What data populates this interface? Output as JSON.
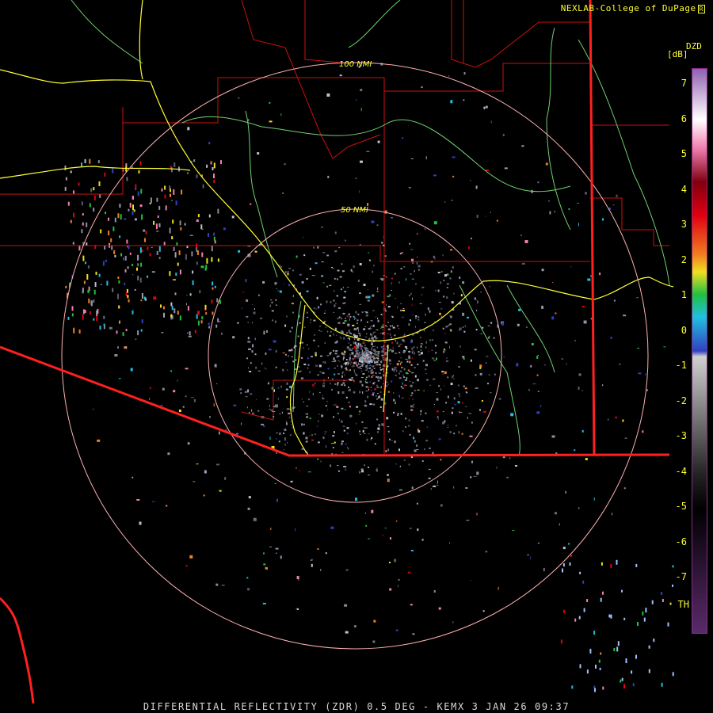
{
  "header": {
    "credit": "NEXLAB-College of DuPage",
    "credit_mark": "R"
  },
  "legend": {
    "product_code": "DZD",
    "unit": "[dB]",
    "ticks": [
      "7",
      "6",
      "5",
      "4",
      "3",
      "2",
      "1",
      "0",
      "-1",
      "-2",
      "-3",
      "-4",
      "-5",
      "-6",
      "-7",
      "TH"
    ],
    "colors": {
      "low_purple": "#5a2a6a",
      "grey_dark": "#222222",
      "grey_light": "#d0d0d0",
      "blue": "#3040c0",
      "cyan": "#20c0e0",
      "green": "#20c040",
      "yellow": "#f0e020",
      "orange": "#f08020",
      "red": "#e00010",
      "dark_red": "#800010",
      "pink": "#f080b0",
      "white": "#ffffff",
      "violet": "#9060b0"
    }
  },
  "map": {
    "range_rings": [
      "100 NMI",
      "50 NMI"
    ],
    "colors": {
      "state_border": "#ff2020",
      "county_border": "#cc1010",
      "highway": "#ffff33",
      "river": "#70d070",
      "range_ring": "#ffb0b0"
    }
  },
  "caption": "DIFFERENTIAL REFLECTIVITY (ZDR) 0.5 DEG - KEMX 3 JAN 26 09:37"
}
